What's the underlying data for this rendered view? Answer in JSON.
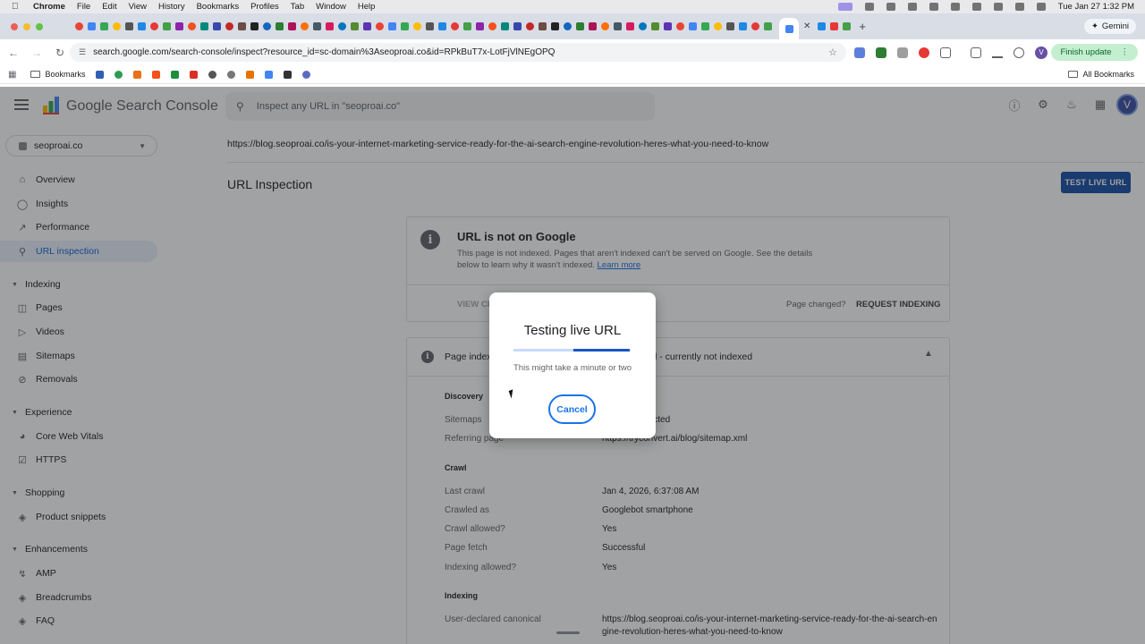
{
  "menubar": {
    "app": "Chrome",
    "menus": [
      "File",
      "Edit",
      "View",
      "History",
      "Bookmarks",
      "Profiles",
      "Tab",
      "Window",
      "Help"
    ],
    "clock": "Tue Jan 27  1:32 PM"
  },
  "browser": {
    "gemini_label": "Gemini",
    "url": "search.google.com/search-console/inspect?resource_id=sc-domain%3Aseoproai.co&id=RPkBuT7x-LotFjVlNEgOPQ",
    "profile_initial": "V",
    "finish_update_label": "Finish update",
    "bookmarks_label": "Bookmarks",
    "all_bookmarks_label": "All Bookmarks"
  },
  "header": {
    "product_name": "Google Search Console",
    "search_placeholder": "Inspect any URL in \"seoproai.co\"",
    "avatar_initial": "V"
  },
  "sidebar": {
    "property": "seoproai.co",
    "items_top": [
      {
        "label": "Overview",
        "icon": "home-icon"
      },
      {
        "label": "Insights",
        "icon": "lightbulb-icon"
      },
      {
        "label": "Performance",
        "icon": "trending-icon"
      },
      {
        "label": "URL inspection",
        "icon": "search-icon",
        "active": true
      }
    ],
    "sections": [
      {
        "title": "Indexing",
        "items": [
          "Pages",
          "Videos",
          "Sitemaps",
          "Removals"
        ]
      },
      {
        "title": "Experience",
        "items": [
          "Core Web Vitals",
          "HTTPS"
        ]
      },
      {
        "title": "Shopping",
        "items": [
          "Product snippets"
        ]
      },
      {
        "title": "Enhancements",
        "items": [
          "AMP",
          "Breadcrumbs",
          "FAQ"
        ]
      }
    ]
  },
  "main": {
    "inspected_url": "https://blog.seoproai.co/is-your-internet-marketing-service-ready-for-the-ai-search-engine-revolution-heres-what-you-need-to-know",
    "page_title": "URL Inspection",
    "test_live_url_label": "TEST LIVE URL",
    "status_card": {
      "title": "URL is not on Google",
      "body": "This page is not indexed. Pages that aren't indexed can't be served on Google. See the details below to learn why it wasn't indexed.",
      "learn_more": "Learn more",
      "view_crawled_label": "VIEW CR",
      "page_changed_label": "Page changed?",
      "request_indexing_label": "REQUEST INDEXING"
    },
    "indexing_card": {
      "header": "Page indexi",
      "status": "xed: Crawled - currently not indexed",
      "discovery_title": "Discovery",
      "sitemaps_label": "Sitemaps",
      "sitemaps_value": "itemaps detected",
      "referring_label": "Referring page",
      "referring_value": "https://tryconvert.ai/blog/sitemap.xml",
      "crawl_title": "Crawl",
      "crawl_rows": [
        {
          "label": "Last crawl",
          "value": "Jan 4, 2026, 6:37:08 AM"
        },
        {
          "label": "Crawled as",
          "value": "Googlebot smartphone"
        },
        {
          "label": "Crawl allowed?",
          "value": "Yes"
        },
        {
          "label": "Page fetch",
          "value": "Successful"
        },
        {
          "label": "Indexing allowed?",
          "value": "Yes"
        }
      ],
      "indexing_title": "Indexing",
      "canonical_label": "User-declared canonical",
      "canonical_value": "https://blog.seoproai.co/is-your-internet-marketing-service-ready-for-the-ai-search-engine-revolution-heres-what-you-need-to-know"
    }
  },
  "dialog": {
    "title": "Testing live URL",
    "subtitle": "This might take a minute or two",
    "cancel_label": "Cancel"
  }
}
